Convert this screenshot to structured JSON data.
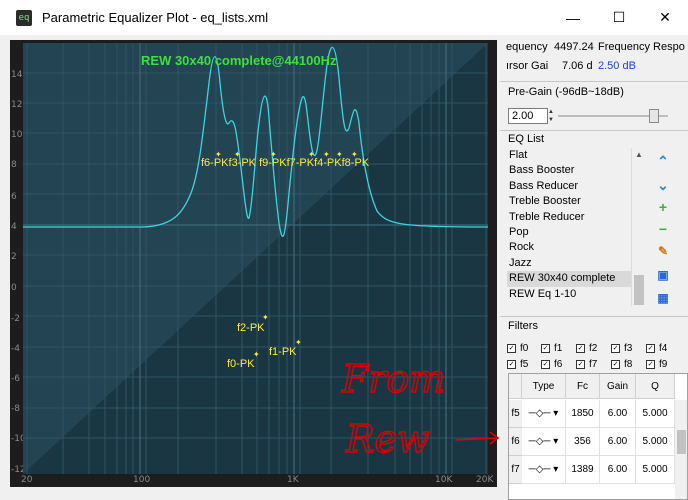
{
  "window": {
    "title": "Parametric Equalizer Plot - eq_lists.xml",
    "app_icon_text": "eq",
    "minimize": "—",
    "maximize": "☐",
    "close": "✕"
  },
  "plot": {
    "title": "REW 30x40 complete@44100Hz",
    "title_color": "#39e23a",
    "curve_color": "#3ad6e0",
    "marker_color": "#ffeb3b",
    "y_ticks": [
      "14",
      "12",
      "10",
      "8",
      "6",
      "4",
      "2",
      "0",
      "-2",
      "-4",
      "-6",
      "-8",
      "-10",
      "-12"
    ],
    "x_ticks": [
      "20",
      "100",
      "1K",
      "10K",
      "20K"
    ],
    "markers_top": "f6-PKf3-PK f9-PKf7-PKf4-PKf8-PK",
    "markers_low": [
      {
        "label": "f2-PK"
      },
      {
        "label": "f1-PK"
      },
      {
        "label": "f0-PK"
      }
    ],
    "annotation_text_1": "From",
    "annotation_text_2": "Rew",
    "annotation_color": "#e00000"
  },
  "readouts": {
    "frequency_label": "equency",
    "frequency_value": "4497.24",
    "freq_response_label": "Frequency Respo",
    "cursor_gain_label": "ırsor Gai",
    "cursor_gain_value": "7.06 d",
    "response_value": "2.50 dB",
    "response_color": "#1f3fd6"
  },
  "pregain": {
    "label": "Pre-Gain (-96dB~18dB)",
    "value": "2.00",
    "level_fraction": 0.87
  },
  "eq_list": {
    "label": "EQ List",
    "items": [
      "Flat",
      "Bass Booster",
      "Bass Reducer",
      "Treble Booster",
      "Treble Reducer",
      "Pop",
      "Rock",
      "Jazz",
      "REW 30x40 complete",
      "REW Eq 1-10"
    ],
    "selected": "REW 30x40 complete"
  },
  "side_buttons": [
    "up-arrow-icon",
    "down-arrow-icon",
    "add-icon",
    "remove-icon",
    "edit-icon",
    "save-icon",
    "import-icon"
  ],
  "filters": {
    "label": "Filters",
    "checks_row1": [
      "f0",
      "f1",
      "f2",
      "f3",
      "f4"
    ],
    "checks_row2": [
      "f5",
      "f6",
      "f7",
      "f8",
      "f9"
    ],
    "headers": [
      "Type",
      "Fc",
      "Gain",
      "Q"
    ],
    "rows": [
      {
        "id": "f5",
        "fc": "1850",
        "gain": "6.00",
        "q": "5.000"
      },
      {
        "id": "f6",
        "fc": "356",
        "gain": "6.00",
        "q": "5.000"
      },
      {
        "id": "f7",
        "fc": "1389",
        "gain": "6.00",
        "q": "5.000"
      }
    ],
    "type_glyph": "─◇─ ▾"
  }
}
